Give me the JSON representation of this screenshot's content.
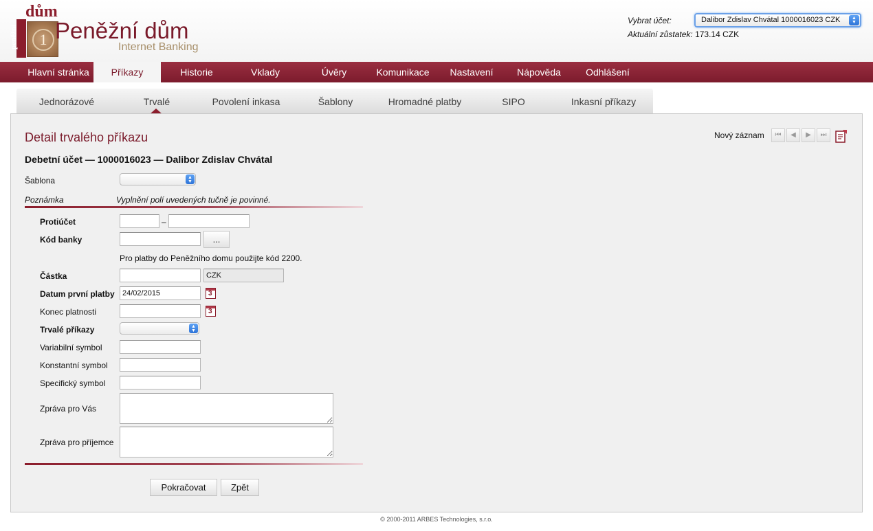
{
  "brand": {
    "logo_vertical": "peněžní",
    "logo_dum": "dům",
    "logo_coin": "1",
    "name": "Peněžní dům",
    "subtitle": "Internet Banking"
  },
  "account": {
    "select_label": "Vybrat účet:",
    "selected": "Dalibor Zdislav Chvátal 1000016023 CZK",
    "balance_label": "Aktuální zůstatek:",
    "balance_value": "173.14 CZK"
  },
  "main_nav": [
    {
      "label": "Hlavní stránka",
      "active": false
    },
    {
      "label": "Příkazy",
      "active": true
    },
    {
      "label": "Historie",
      "active": false
    },
    {
      "label": "Vklady",
      "active": false
    },
    {
      "label": "Úvěry",
      "active": false
    },
    {
      "label": "Komunikace",
      "active": false
    },
    {
      "label": "Nastavení",
      "active": false
    },
    {
      "label": "Nápověda",
      "active": false
    },
    {
      "label": "Odhlášení",
      "active": false
    }
  ],
  "sub_nav": [
    {
      "label": "Jednorázové",
      "active": false
    },
    {
      "label": "Trvalé",
      "active": true
    },
    {
      "label": "Povolení inkasa",
      "active": false
    },
    {
      "label": "Šablony",
      "active": false
    },
    {
      "label": "Hromadné platby",
      "active": false
    },
    {
      "label": "SIPO",
      "active": false
    },
    {
      "label": "Inkasní příkazy",
      "active": false
    }
  ],
  "page": {
    "title": "Detail trvalého příkazu",
    "new_record": "Nový záznam",
    "debit_title": "Debetní účet — 1000016023 — Dalibor Zdislav Chvátal"
  },
  "form": {
    "sablona_label": "Šablona",
    "note_label": "Poznámka",
    "note_text": "Vyplnění polí uvedených tučně je povinné.",
    "protiucet_label": "Protiúčet",
    "protiucet_sep": "–",
    "kod_banky_label": "Kód banky",
    "kod_banky_button": "...",
    "bank_hint": "Pro platby do Peněžního domu použijte kód 2200.",
    "castka_label": "Částka",
    "currency": "CZK",
    "datum_label": "Datum první platby",
    "datum_value": "24/02/2015",
    "konec_label": "Konec platnosti",
    "trvale_label": "Trvalé příkazy",
    "vs_label": "Variabilní symbol",
    "ks_label": "Konstantní symbol",
    "ss_label": "Specifický symbol",
    "zprava_vas_label": "Zpráva pro Vás",
    "zprava_prijemce_label": "Zpráva pro příjemce",
    "continue_button": "Pokračovat",
    "back_button": "Zpět"
  },
  "footer": {
    "copyright": "© 2000-2011 ARBES Technologies, s.r.o."
  },
  "colors": {
    "brand": "#8b1d2c",
    "panel": "#f0f0f0",
    "title": "#7a1a2a"
  },
  "icons": {
    "calendar": "calendar-icon",
    "first": "first-record-icon",
    "prev": "prev-record-icon",
    "next": "next-record-icon",
    "last": "last-record-icon",
    "doc": "new-document-icon"
  }
}
